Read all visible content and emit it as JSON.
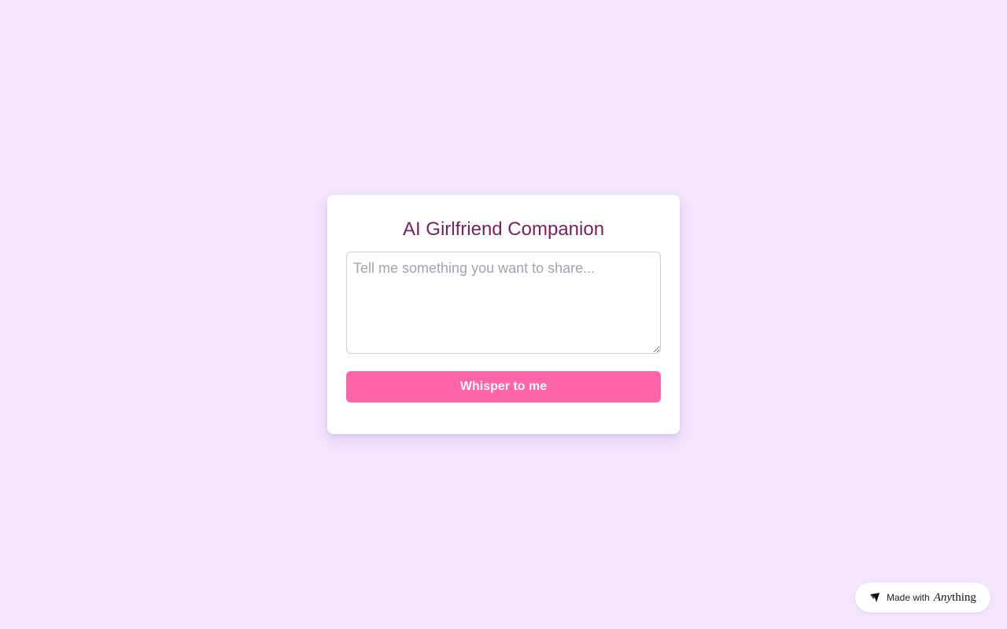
{
  "page": {
    "background_color": "#f3e5fe"
  },
  "card": {
    "title": "AI Girlfriend Companion",
    "title_color": "#7a1f5e",
    "message_input": {
      "value": "",
      "placeholder": "Tell me something you want to share..."
    },
    "submit_label": "Whisper to me",
    "button_color": "#ff63a8"
  },
  "badge": {
    "prefix": "Made with",
    "brand_part1": "Any",
    "brand_part2": "thing",
    "icon": "anything-logo-icon"
  }
}
